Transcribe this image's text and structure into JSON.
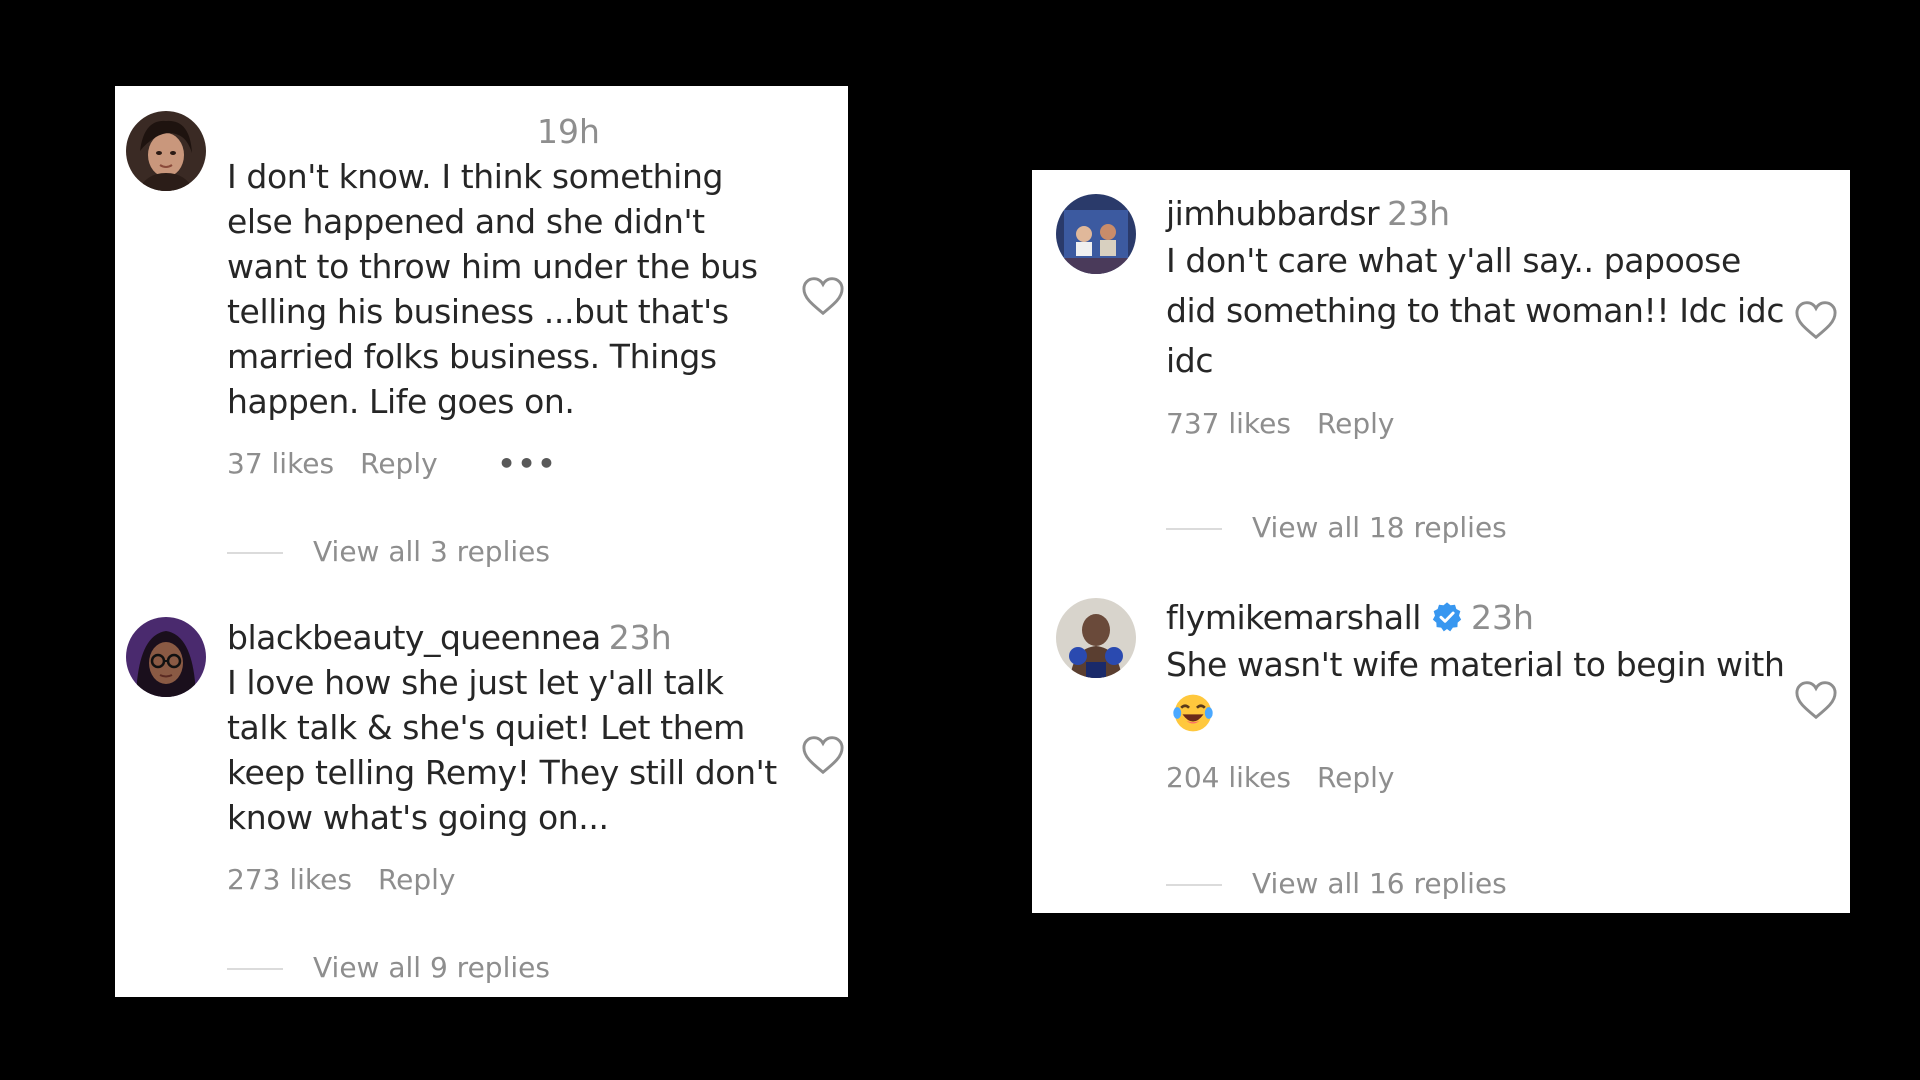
{
  "comments_left": [
    {
      "username": "",
      "time": "19h",
      "text": "I don't know. I think something else happened and she didn't want to throw him under the bus telling his business ...but that's married folks business. Things happen. Life goes on.",
      "likes": "37 likes",
      "reply": "Reply",
      "more": "•••",
      "view_replies": "View all 3 replies",
      "avatar_icon": "avatar-woman-photo"
    },
    {
      "username": "blackbeauty_queennea",
      "time": "23h",
      "text": "I love how she just let y'all talk talk talk & she's quiet! Let them keep telling Remy! They still don't know what's going on...",
      "likes": "273 likes",
      "reply": "Reply",
      "view_replies": "View all 9 replies",
      "avatar_icon": "avatar-woman-glasses"
    }
  ],
  "comments_right": [
    {
      "username": "jimhubbardsr",
      "time": "23h",
      "text": "I don't care what y'all say.. papoose did something to that woman!! Idc idc idc",
      "likes": "737 likes",
      "reply": "Reply",
      "view_replies": "View all 18 replies",
      "avatar_icon": "avatar-group-photo"
    },
    {
      "username": "flymikemarshall",
      "time": "23h",
      "text": "She wasn't wife material to begin with",
      "emoji": "laughing-tears-emoji",
      "likes": "204 likes",
      "reply": "Reply",
      "view_replies": "View all 16 replies",
      "verified": true,
      "avatar_icon": "avatar-boxer-photo"
    }
  ],
  "colors": {
    "background": "#000000",
    "panel": "#ffffff",
    "text_primary": "#262626",
    "text_secondary": "#8e8e8e",
    "verified_blue": "#3897f0",
    "heart_outline": "#8e8e8e"
  }
}
